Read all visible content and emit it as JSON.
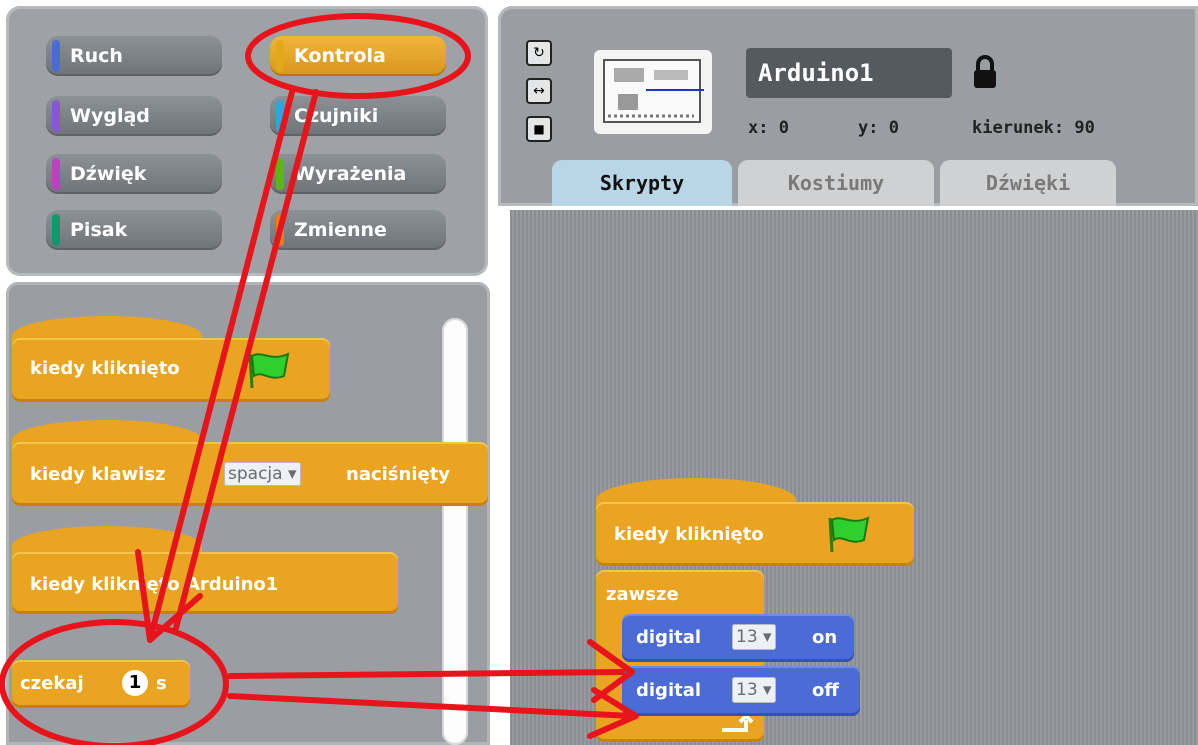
{
  "categories": [
    {
      "label": "Ruch",
      "color": "#4a6cd4"
    },
    {
      "label": "Kontrola",
      "color": "#e1a91a"
    },
    {
      "label": "Wygląd",
      "color": "#8a55d7"
    },
    {
      "label": "Czujniki",
      "color": "#2ca5e2"
    },
    {
      "label": "Dźwięk",
      "color": "#bb42c3"
    },
    {
      "label": "Wyrażenia",
      "color": "#5cb712"
    },
    {
      "label": "Pisak",
      "color": "#0e9a6c"
    },
    {
      "label": "Zmienne",
      "color": "#ee7d16"
    }
  ],
  "palette": {
    "hat1_label": "kiedy kliknięto",
    "hat2_label_a": "kiedy klawisz",
    "hat2_dropdown": "spacja",
    "hat2_label_b": "naciśnięty",
    "hat3_label": "kiedy kliknięto  Arduino1",
    "wait_label": "czekaj",
    "wait_value": "1",
    "wait_unit": "s"
  },
  "sprite": {
    "name": "Arduino1",
    "x_label": "x: 0",
    "y_label": "y: 0",
    "direction_label": "kierunek: 90"
  },
  "tabs": [
    "Skrypty",
    "Kostiumy",
    "Dźwięki"
  ],
  "script": {
    "hat_label": "kiedy kliknięto",
    "forever_label": "zawsze",
    "cmd1_label": "digital",
    "cmd1_pin": "13",
    "cmd1_state": "on",
    "cmd2_label": "digital",
    "cmd2_pin": "13",
    "cmd2_state": "off"
  },
  "colors": {
    "control": "#e9a521",
    "motion": "#4a6cd4",
    "annotation": "#e8141b"
  }
}
